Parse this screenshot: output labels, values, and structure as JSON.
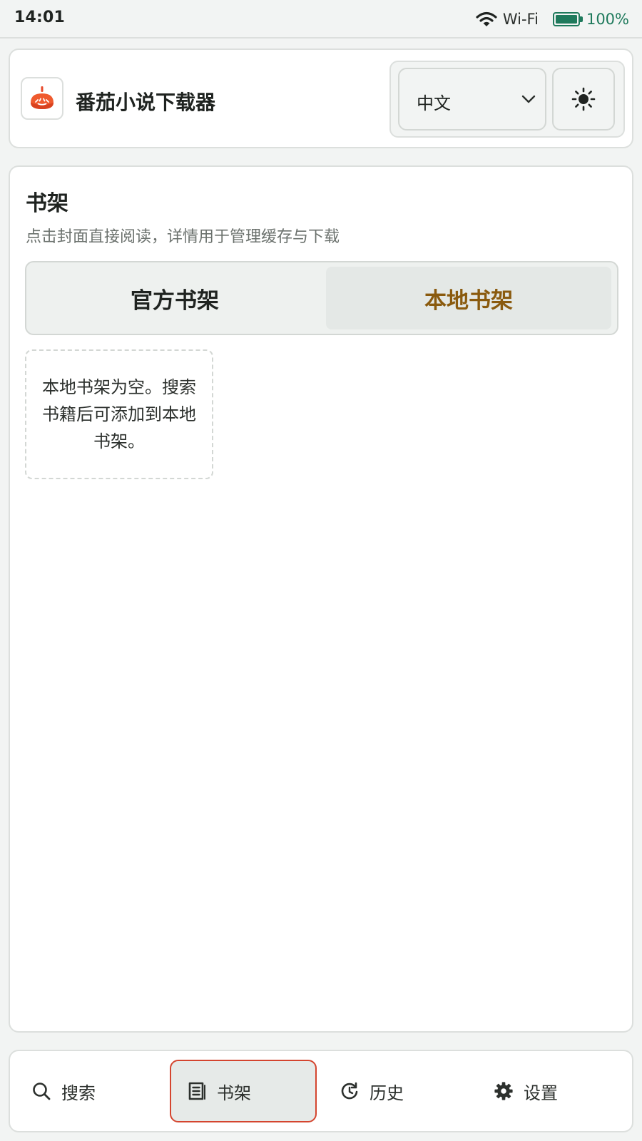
{
  "status_bar": {
    "time": "14:01",
    "wifi_label": "Wi-Fi",
    "battery_label": "100%",
    "battery_level": 1.0,
    "battery_color": "#1f7a5c"
  },
  "header": {
    "logo_icon": "tomato-download-icon",
    "app_title": "番茄小说下载器",
    "language": {
      "selected": "中文",
      "icon": "chevron-down-icon"
    },
    "theme_toggle_icon": "sun-icon"
  },
  "main": {
    "title": "书架",
    "subtitle": "点击封面直接阅读，详情用于管理缓存与下载",
    "tabs": [
      {
        "label": "官方书架",
        "active": false
      },
      {
        "label": "本地书架",
        "active": true
      }
    ],
    "active_tab_color": "#8a5a0e",
    "empty_message": "本地书架为空。搜索书籍后可添加到本地书架。"
  },
  "bottom_nav": {
    "active_border_color": "#d4452f",
    "items": [
      {
        "label": "搜索",
        "icon": "search-icon",
        "active": false
      },
      {
        "label": "书架",
        "icon": "bookshelf-icon",
        "active": true
      },
      {
        "label": "历史",
        "icon": "history-icon",
        "active": false
      },
      {
        "label": "设置",
        "icon": "gear-icon",
        "active": false
      }
    ]
  }
}
